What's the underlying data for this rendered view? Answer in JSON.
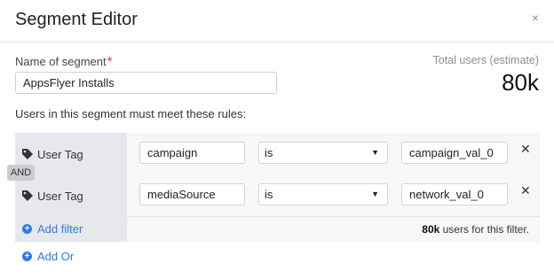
{
  "header": {
    "title": "Segment Editor",
    "close_glyph": "×"
  },
  "segment": {
    "name_label": "Name of segment",
    "required_marker": "*",
    "name_value": "AppsFlyer Installs"
  },
  "totals": {
    "label": "Total users (estimate)",
    "value": "80k"
  },
  "rules_text": "Users in this segment must meet these rules:",
  "rules": [
    {
      "type_label": "User Tag",
      "type_icon": "tag-icon",
      "property": "campaign",
      "operator": "is",
      "value": "campaign_val_0"
    },
    {
      "type_label": "User Tag",
      "type_icon": "tag-icon",
      "property": "mediaSource",
      "operator": "is",
      "value": "network_val_0"
    }
  ],
  "connector_label": "AND",
  "remove_glyph": "✕",
  "add_filter_label": "Add filter",
  "add_or_label": "Add Or",
  "filter_count": {
    "value": "80k",
    "suffix": " users for this filter."
  },
  "colors": {
    "link": "#2d7be5",
    "required": "#e53935",
    "filter_bg": "#f7f7f7",
    "filter_left_bg": "#e6e8eb"
  }
}
